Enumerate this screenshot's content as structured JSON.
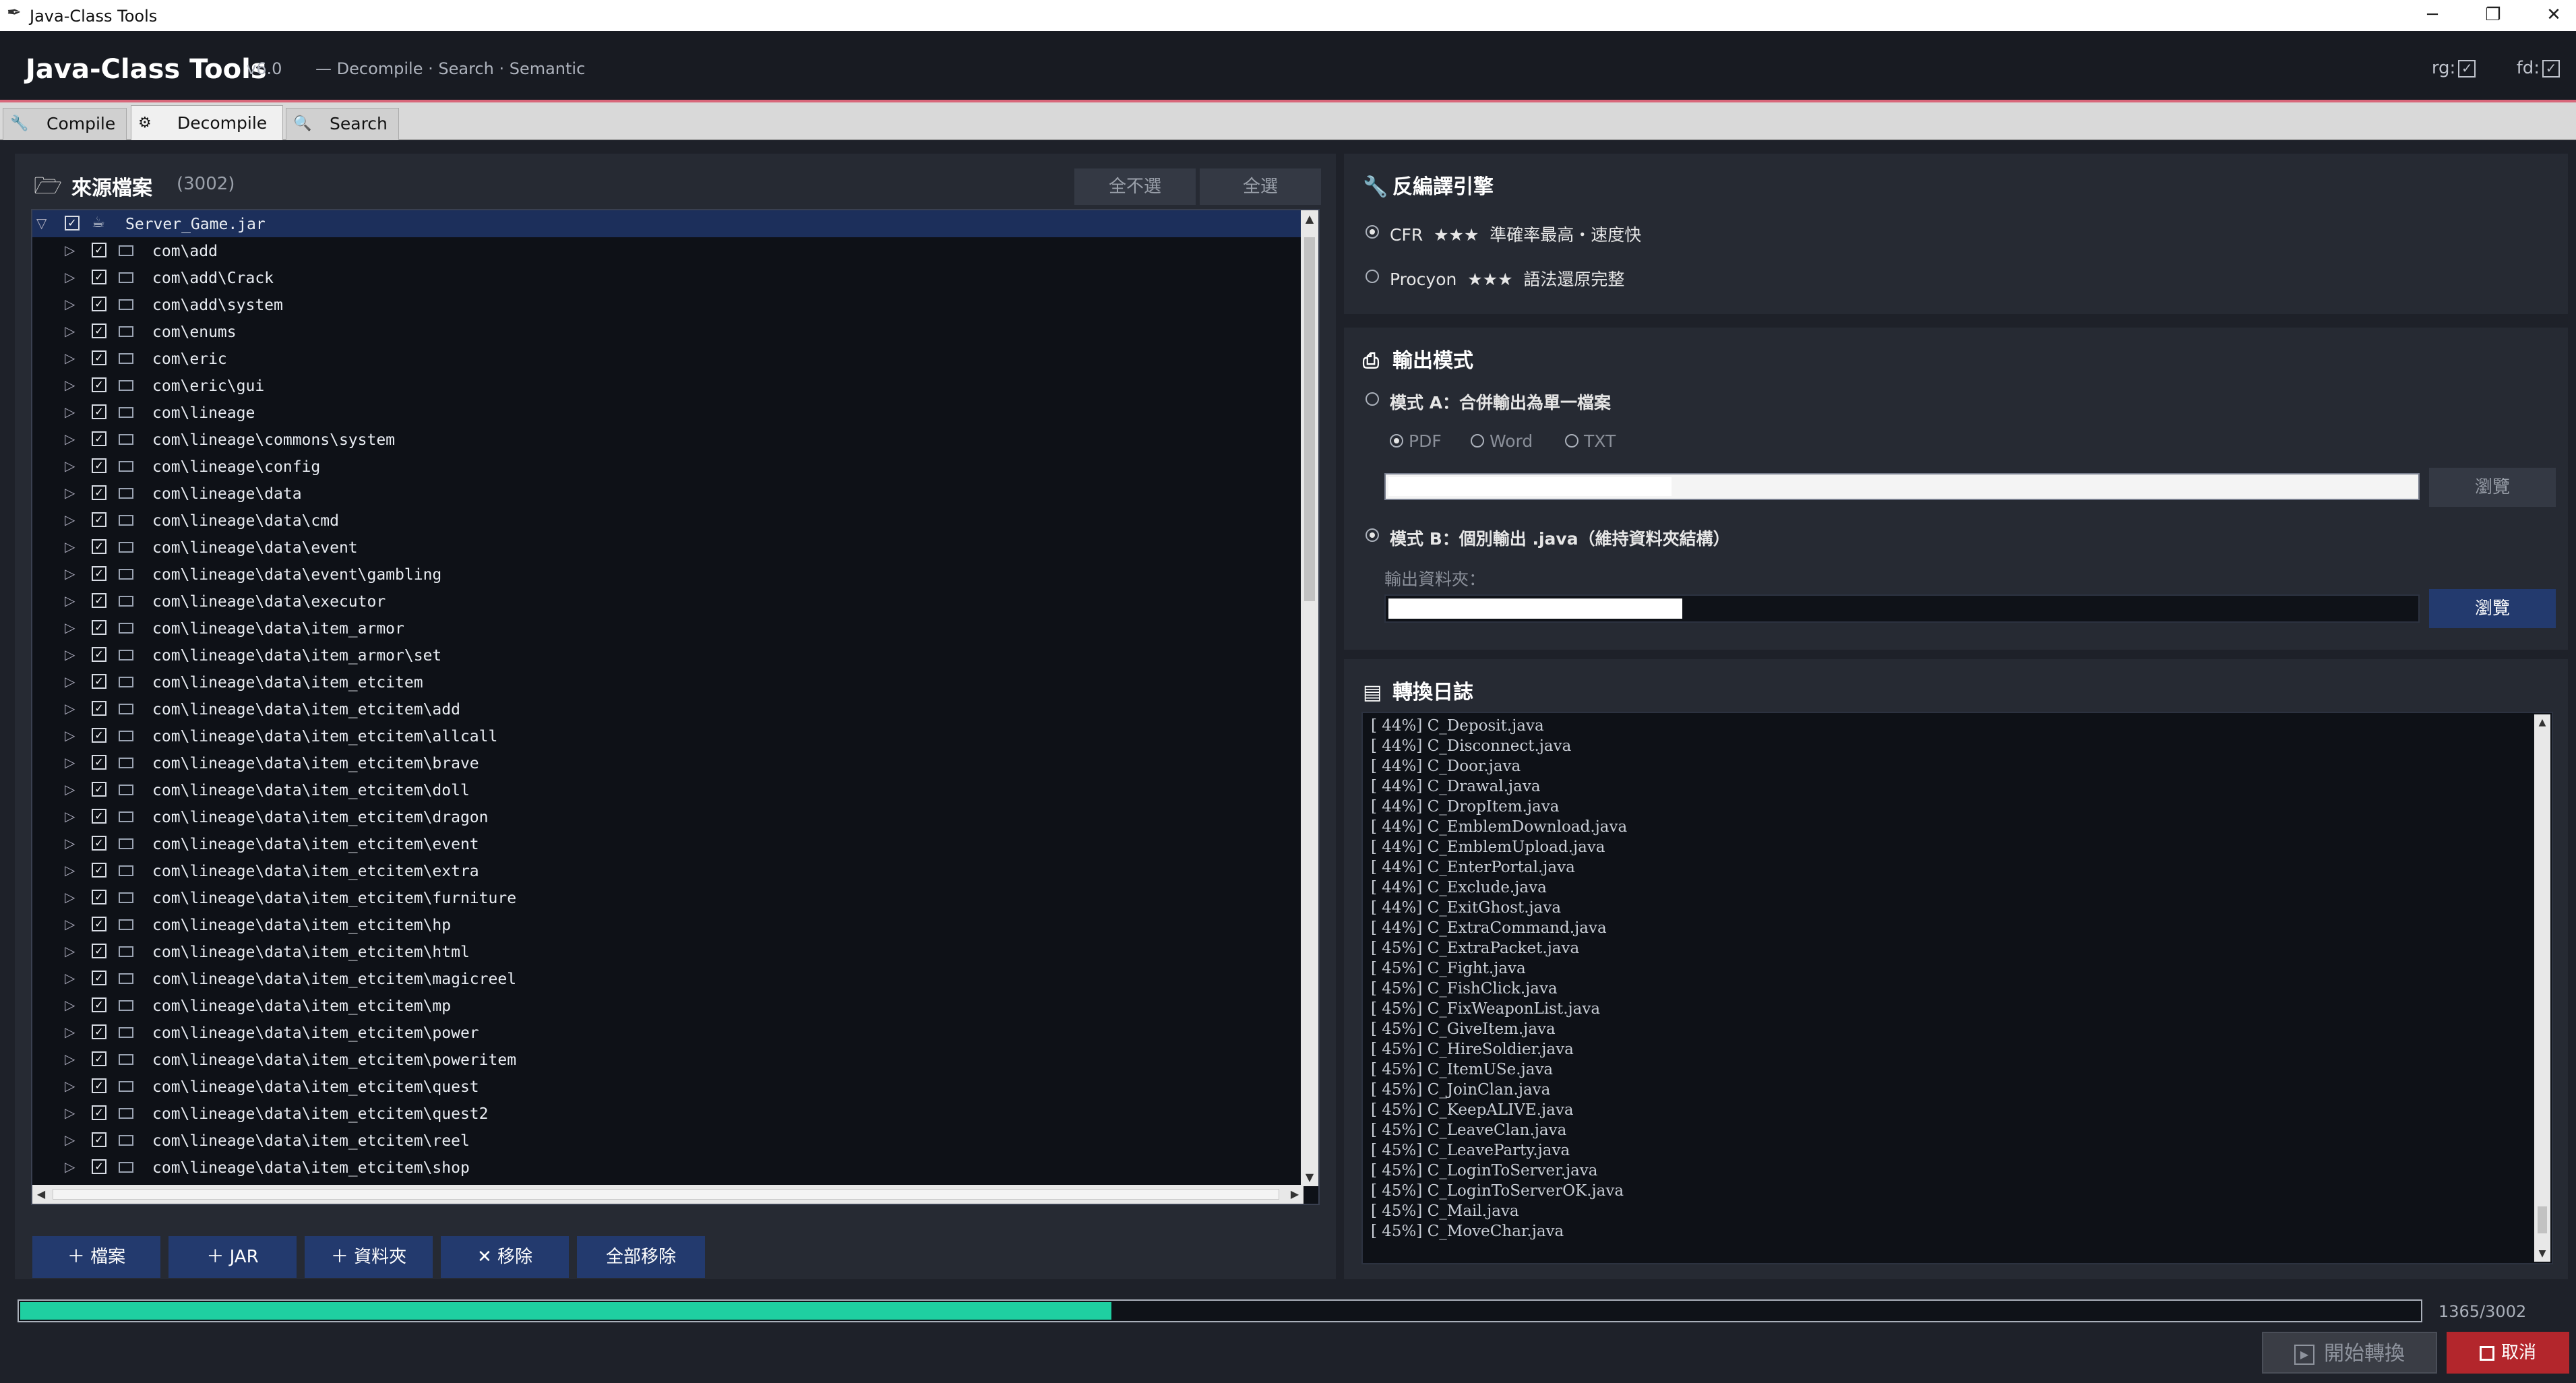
{
  "window": {
    "title": "Java-Class Tools",
    "controls": [
      "─",
      "❐",
      "✕"
    ]
  },
  "header": {
    "app_name": "Java-Class Tools",
    "version": "v6.0",
    "subtitle": "— Decompile · Search · Semantic",
    "toggle_rg": "rg:",
    "toggle_fd": "fd:"
  },
  "tabs": [
    {
      "label": "Compile",
      "icon": "wrench-icon"
    },
    {
      "label": "Decompile",
      "icon": "gear-icon"
    },
    {
      "label": "Search",
      "icon": "search-icon"
    }
  ],
  "source": {
    "title": "來源檔案",
    "count": "(3002)",
    "deselect_all": "全不選",
    "select_all": "全選",
    "root": "Server_Game.jar",
    "packages": [
      "com\\add",
      "com\\add\\Crack",
      "com\\add\\system",
      "com\\enums",
      "com\\eric",
      "com\\eric\\gui",
      "com\\lineage",
      "com\\lineage\\commons\\system",
      "com\\lineage\\config",
      "com\\lineage\\data",
      "com\\lineage\\data\\cmd",
      "com\\lineage\\data\\event",
      "com\\lineage\\data\\event\\gambling",
      "com\\lineage\\data\\executor",
      "com\\lineage\\data\\item_armor",
      "com\\lineage\\data\\item_armor\\set",
      "com\\lineage\\data\\item_etcitem",
      "com\\lineage\\data\\item_etcitem\\add",
      "com\\lineage\\data\\item_etcitem\\allcall",
      "com\\lineage\\data\\item_etcitem\\brave",
      "com\\lineage\\data\\item_etcitem\\doll",
      "com\\lineage\\data\\item_etcitem\\dragon",
      "com\\lineage\\data\\item_etcitem\\event",
      "com\\lineage\\data\\item_etcitem\\extra",
      "com\\lineage\\data\\item_etcitem\\furniture",
      "com\\lineage\\data\\item_etcitem\\hp",
      "com\\lineage\\data\\item_etcitem\\html",
      "com\\lineage\\data\\item_etcitem\\magicreel",
      "com\\lineage\\data\\item_etcitem\\mp",
      "com\\lineage\\data\\item_etcitem\\power",
      "com\\lineage\\data\\item_etcitem\\poweritem",
      "com\\lineage\\data\\item_etcitem\\quest",
      "com\\lineage\\data\\item_etcitem\\quest2",
      "com\\lineage\\data\\item_etcitem\\reel",
      "com\\lineage\\data\\item_etcitem\\shop"
    ],
    "buttons": [
      "＋ 檔案",
      "＋ JAR",
      "＋ 資料夾",
      "✕ 移除",
      "全部移除"
    ]
  },
  "engine": {
    "title": "反編譯引擎",
    "options": [
      {
        "name": "CFR",
        "stars": "★★★",
        "desc": "準確率最高・速度快",
        "selected": true
      },
      {
        "name": "Procyon",
        "stars": "★★★",
        "desc": "語法還原完整",
        "selected": false
      }
    ]
  },
  "output": {
    "title": "輸出模式",
    "mode_a": "模式 A：合併輸出為單一檔案",
    "formats": [
      "PDF",
      "Word",
      "TXT"
    ],
    "browse": "瀏覽",
    "mode_b": "模式 B：個別輸出 .java（維持資料夾結構）",
    "folder_label": "輸出資料夾：",
    "browse_b": "瀏覽"
  },
  "log": {
    "title": "轉換日誌",
    "lines": [
      "[ 44%] C_Deposit.java",
      "[ 44%] C_Disconnect.java",
      "[ 44%] C_Door.java",
      "[ 44%] C_Drawal.java",
      "[ 44%] C_DropItem.java",
      "[ 44%] C_EmblemDownload.java",
      "[ 44%] C_EmblemUpload.java",
      "[ 44%] C_EnterPortal.java",
      "[ 44%] C_Exclude.java",
      "[ 44%] C_ExitGhost.java",
      "[ 44%] C_ExtraCommand.java",
      "[ 45%] C_ExtraPacket.java",
      "[ 45%] C_Fight.java",
      "[ 45%] C_FishClick.java",
      "[ 45%] C_FixWeaponList.java",
      "[ 45%] C_GiveItem.java",
      "[ 45%] C_HireSoldier.java",
      "[ 45%] C_ItemUSe.java",
      "[ 45%] C_JoinClan.java",
      "[ 45%] C_KeepALIVE.java",
      "[ 45%] C_LeaveClan.java",
      "[ 45%] C_LeaveParty.java",
      "[ 45%] C_LoginToServer.java",
      "[ 45%] C_LoginToServerOK.java",
      "[ 45%] C_Mail.java",
      "[ 45%] C_MoveChar.java"
    ]
  },
  "progress": {
    "value": 1365,
    "total": 3002,
    "label": "1365/3002",
    "fraction": 0.4547
  },
  "actions": {
    "start": "開始轉換",
    "cancel": "取消"
  },
  "colors": {
    "accent": "#1fcfa1",
    "header_line": "#d8677a",
    "button": "#233a6e",
    "cancel": "#b3262c"
  }
}
